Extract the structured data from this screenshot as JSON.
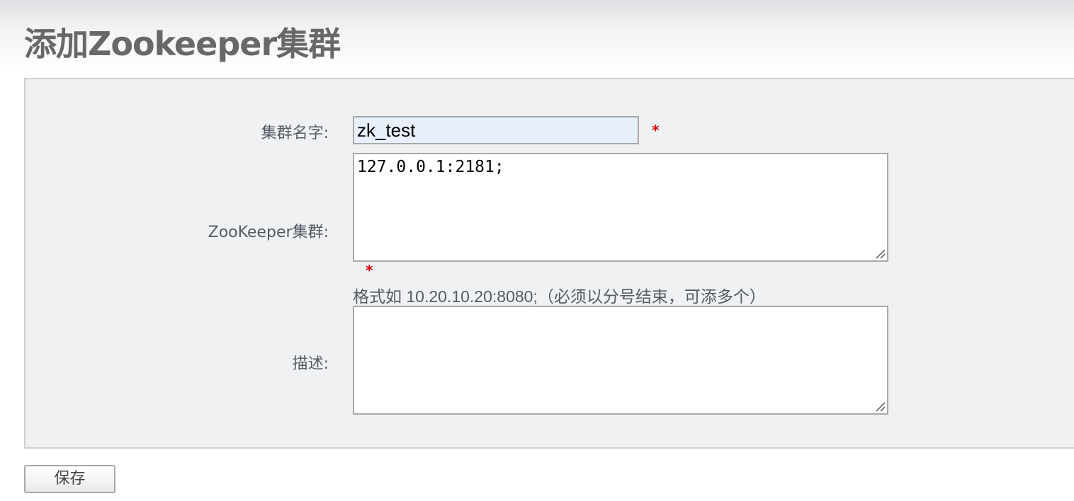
{
  "page": {
    "title": "添加Zookeeper集群"
  },
  "form": {
    "cluster_name": {
      "label": "集群名字:",
      "value": "zk_test",
      "required_mark": "*"
    },
    "zk_cluster": {
      "label": "ZooKeeper集群:",
      "value": "127.0.0.1:2181;",
      "required_mark": "*",
      "hint": "格式如 10.20.10.20:8080;（必须以分号结束，可添多个）"
    },
    "description": {
      "label": "描述:",
      "value": ""
    }
  },
  "actions": {
    "save_label": "保存"
  },
  "colors": {
    "title": "#686868",
    "panel_bg": "#f0f1f3",
    "required": "#d20000",
    "autofill_bg": "#e8f0fe"
  },
  "icons": {
    "resize_handle": "resize-grip-icon"
  }
}
